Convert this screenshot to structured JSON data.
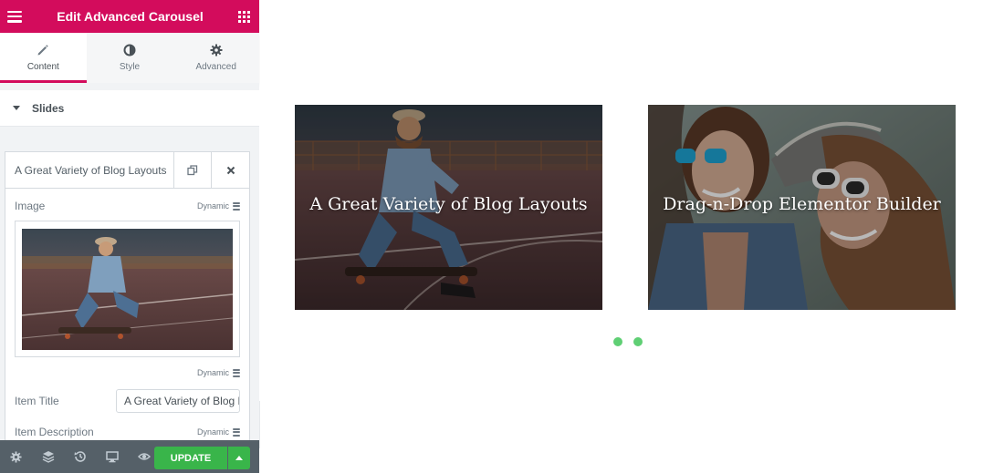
{
  "panel": {
    "title": "Edit Advanced Carousel",
    "tabs": [
      {
        "label": "Content",
        "icon": "pencil-icon",
        "active": true
      },
      {
        "label": "Style",
        "icon": "contrast-icon",
        "active": false
      },
      {
        "label": "Advanced",
        "icon": "gear-icon",
        "active": false
      }
    ],
    "section": {
      "label": "Slides"
    },
    "repeater_item": {
      "title": "A Great Variety of Blog Layouts",
      "image_label": "Image",
      "dynamic_label": "Dynamic",
      "item_title_label": "Item Title",
      "item_title_value": "A Great Variety of Blog Layouts",
      "item_description_label": "Item Description"
    },
    "footer": {
      "update_label": "UPDATE"
    }
  },
  "carousel": {
    "slides": [
      {
        "caption": "A Great Variety of Blog Layouts"
      },
      {
        "caption": "Drag-n-Drop Elementor Builder"
      }
    ]
  },
  "colors": {
    "brand": "#d30c5c",
    "update": "#39b54a",
    "footer": "#556068",
    "dot": "#5fcf74"
  }
}
